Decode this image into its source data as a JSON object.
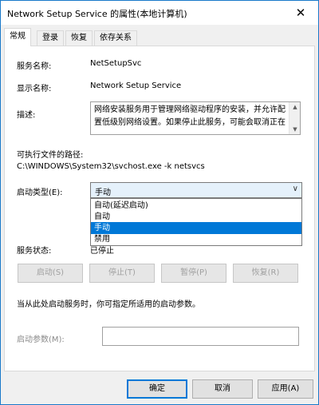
{
  "window": {
    "title": "Network Setup Service 的属性(本地计算机)",
    "close_glyph": "✕"
  },
  "tabs": [
    "常规",
    "登录",
    "恢复",
    "依存关系"
  ],
  "general": {
    "service_name_label": "服务名称:",
    "service_name_value": "NetSetupSvc",
    "display_name_label": "显示名称:",
    "display_name_value": "Network Setup Service",
    "description_label": "描述:",
    "description_text": "网络安装服务用于管理网络驱动程序的安装，并允许配置低级别网络设置。如果停止此服务，可能会取消正在",
    "exe_path_label": "可执行文件的路径:",
    "exe_path_value": "C:\\WINDOWS\\System32\\svchost.exe -k netsvcs",
    "startup_type_label": "启动类型(E):",
    "startup_type_value": "手动",
    "startup_options": [
      "自动(延迟启动)",
      "自动",
      "手动",
      "禁用"
    ],
    "status_label": "服务状态:",
    "status_value": "已停止",
    "hint_text": "当从此处启动服务时，你可指定所适用的启动参数。",
    "params_label": "启动参数(M):",
    "params_value": ""
  },
  "service_buttons": {
    "start": "启动(S)",
    "stop": "停止(T)",
    "pause": "暂停(P)",
    "resume": "恢复(R)"
  },
  "dialog_buttons": {
    "ok": "确定",
    "cancel": "取消",
    "apply": "应用(A)"
  }
}
